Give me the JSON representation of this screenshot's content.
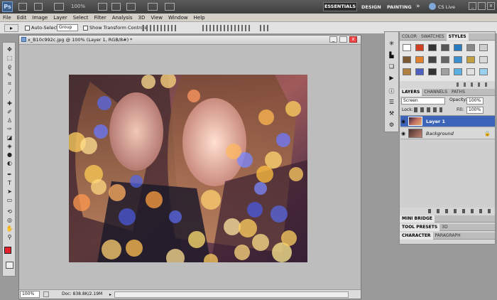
{
  "app": {
    "logo": "Ps",
    "zoom": "100%",
    "workspaces": [
      "ESSENTIALS",
      "DESIGN",
      "PAINTING"
    ],
    "more": "»",
    "cslive": "CS Live"
  },
  "menu": [
    "File",
    "Edit",
    "Image",
    "Layer",
    "Select",
    "Filter",
    "Analysis",
    "3D",
    "View",
    "Window",
    "Help"
  ],
  "options": {
    "auto_select_label": "Auto-Select:",
    "auto_select_value": "Group",
    "show_transform_label": "Show Transform Controls"
  },
  "document": {
    "title": "x_B10c992c.jpg @ 100% (Layer 1, RGB/8#) *",
    "zoom": "100%",
    "doc_info": "Doc: 838.8K/2.19M"
  },
  "swatch_panel": {
    "tabs": [
      "COLOR",
      "SWATCHES",
      "STYLES"
    ],
    "active": "STYLES"
  },
  "layers_panel": {
    "tabs": [
      "LAYERS",
      "CHANNELS",
      "PATHS"
    ],
    "blend_mode": "Screen",
    "opacity_label": "Opacity:",
    "opacity_value": "100%",
    "lock_label": "Lock:",
    "fill_label": "Fill:",
    "fill_value": "100%",
    "layers": [
      {
        "name": "Layer 1",
        "selected": true
      },
      {
        "name": "Background",
        "selected": false
      }
    ]
  },
  "collapsed_panels": {
    "mini_bridge": "MINI BRIDGE",
    "tool_presets": "TOOL PRESETS",
    "three_d": "3D",
    "character": "CHARACTER",
    "paragraph": "PARAGRAPH"
  },
  "colors": {
    "foreground": "#e5202a",
    "background": "#000000",
    "selected_layer": "#3c64b8"
  }
}
